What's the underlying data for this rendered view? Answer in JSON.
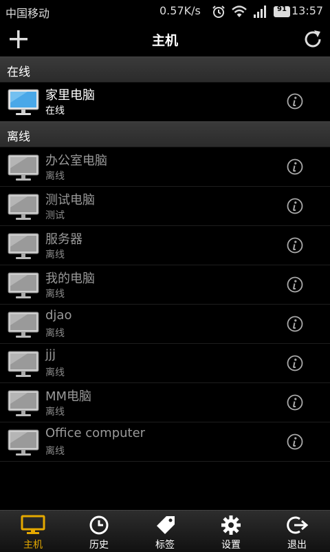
{
  "status_bar": {
    "carrier": "中国移动",
    "speed": "0.57K/s",
    "battery": "91",
    "time": "13:57"
  },
  "header": {
    "title": "主机",
    "add_icon": "plus-icon",
    "refresh_icon": "refresh-icon"
  },
  "online_section": {
    "title": "在线",
    "hosts": [
      {
        "name": "家里电脑",
        "status": "在线"
      }
    ]
  },
  "offline_section": {
    "title": "离线",
    "hosts": [
      {
        "name": "办公室电脑",
        "status": "离线"
      },
      {
        "name": "测试电脑",
        "status": "测试"
      },
      {
        "name": "服务器",
        "status": "离线"
      },
      {
        "name": "我的电脑",
        "status": "离线"
      },
      {
        "name": "djao",
        "status": "离线"
      },
      {
        "name": "jjj",
        "status": "离线"
      },
      {
        "name": "MM电脑",
        "status": "离线"
      },
      {
        "name": "Office computer",
        "status": "离线"
      }
    ]
  },
  "tabs": [
    {
      "label": "主机",
      "icon": "monitor-icon",
      "active": true
    },
    {
      "label": "历史",
      "icon": "clock-icon",
      "active": false
    },
    {
      "label": "标签",
      "icon": "tag-icon",
      "active": false
    },
    {
      "label": "设置",
      "icon": "gear-icon",
      "active": false
    },
    {
      "label": "退出",
      "icon": "exit-icon",
      "active": false
    }
  ],
  "colors": {
    "accent": "#e5a900",
    "section_bg": "#333333",
    "screen_online": "#4aa8e8",
    "screen_offline": "#9a9a9a"
  }
}
